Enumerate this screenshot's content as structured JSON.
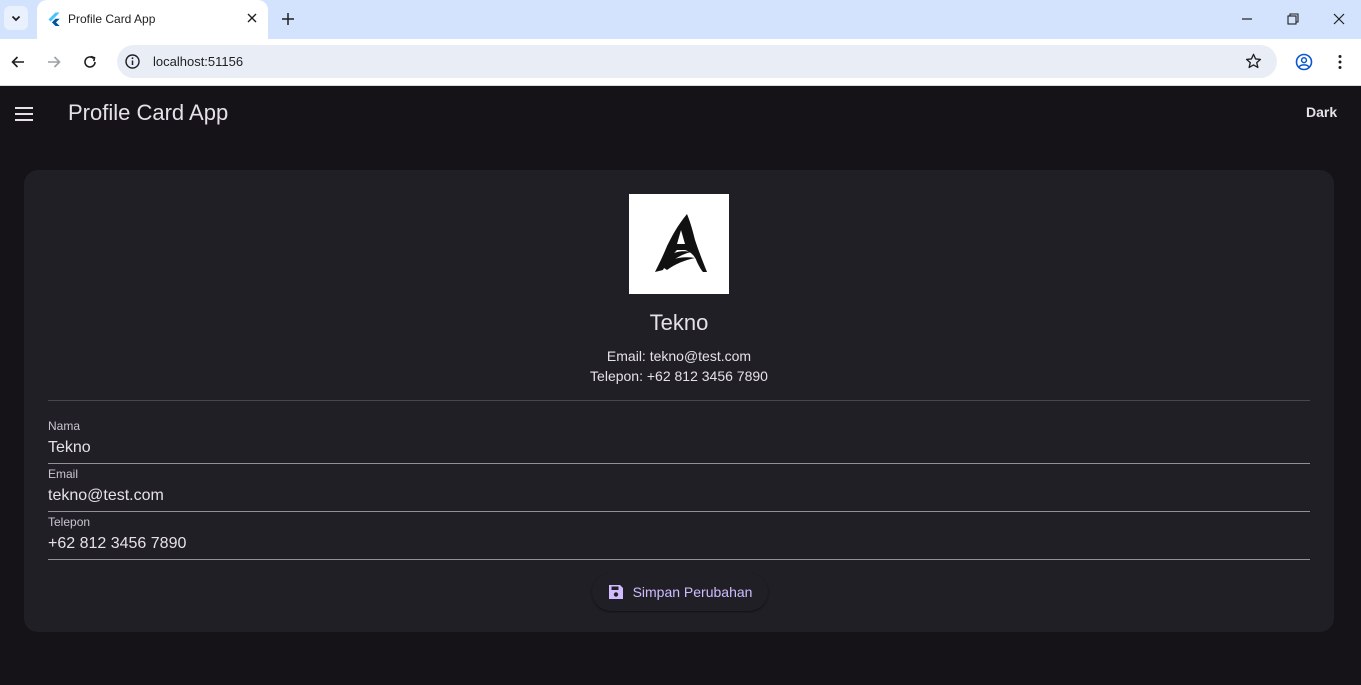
{
  "browser": {
    "tab_title": "Profile Card App",
    "url": "localhost:51156"
  },
  "app": {
    "title": "Profile Card App",
    "theme_toggle": "Dark"
  },
  "profile": {
    "name": "Tekno",
    "email_line": "Email: tekno@test.com",
    "phone_line": "Telepon: +62 812 3456 7890"
  },
  "form": {
    "name_label": "Nama",
    "name_value": "Tekno",
    "email_label": "Email",
    "email_value": "tekno@test.com",
    "phone_label": "Telepon",
    "phone_value": "+62 812 3456 7890",
    "save_label": "Simpan Perubahan"
  },
  "icons": {
    "menu": "menu-icon",
    "save": "save-icon",
    "avatar": "logo-image"
  },
  "colors": {
    "background": "#151218",
    "card": "#211f26",
    "accent": "#d0bcff",
    "text": "#e6e0e9"
  }
}
